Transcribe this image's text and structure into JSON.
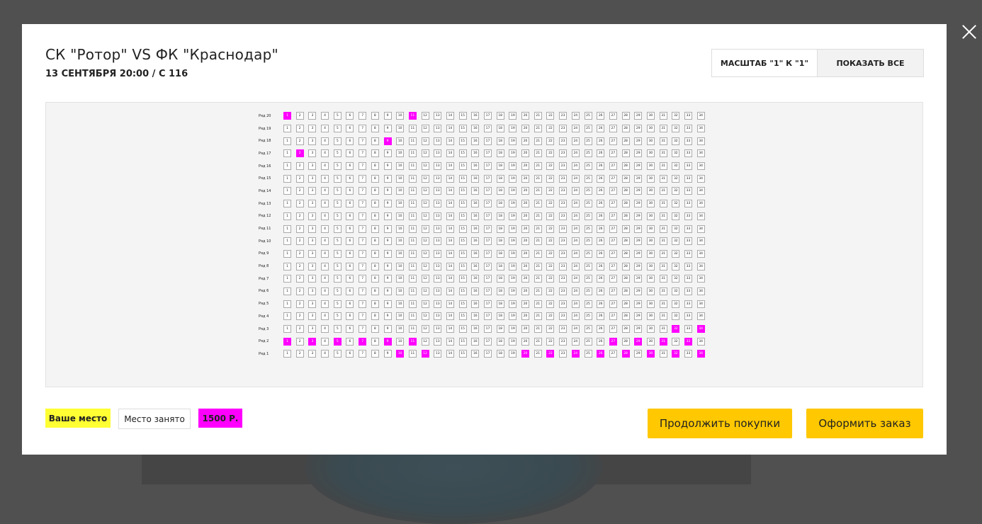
{
  "header": {
    "title": "СК \"Ротор\" VS ФК \"Краснодар\"",
    "subtitle": "13 СЕНТЯБРЯ 20:00 / С 116"
  },
  "toolbar": {
    "scale_label": "МАСШТАБ \"1\" К \"1\"",
    "show_all_label": "ПОКАЗАТЬ ВСЕ"
  },
  "seat_map": {
    "seats_per_row": 34,
    "rows": [
      {
        "label": "Ряд 20",
        "priced": [
          1,
          11
        ]
      },
      {
        "label": "Ряд 19",
        "priced": []
      },
      {
        "label": "Ряд 18",
        "priced": [
          9
        ]
      },
      {
        "label": "Ряд 17",
        "priced": [
          2
        ]
      },
      {
        "label": "Ряд 16",
        "priced": []
      },
      {
        "label": "Ряд 15",
        "priced": []
      },
      {
        "label": "Ряд 14",
        "priced": []
      },
      {
        "label": "Ряд 13",
        "priced": []
      },
      {
        "label": "Ряд 12",
        "priced": []
      },
      {
        "label": "Ряд 11",
        "priced": []
      },
      {
        "label": "Ряд 10",
        "priced": []
      },
      {
        "label": "Ряд 9",
        "priced": []
      },
      {
        "label": "Ряд 8",
        "priced": []
      },
      {
        "label": "Ряд 7",
        "priced": []
      },
      {
        "label": "Ряд 6",
        "priced": []
      },
      {
        "label": "Ряд 5",
        "priced": []
      },
      {
        "label": "Ряд 4",
        "priced": []
      },
      {
        "label": "Ряд 3",
        "priced": [
          32,
          34
        ]
      },
      {
        "label": "Ряд 2",
        "priced": [
          1,
          3,
          5,
          7,
          9,
          11,
          27,
          29,
          31,
          33
        ]
      },
      {
        "label": "Ряд 1",
        "priced": [
          10,
          12,
          20,
          22,
          24,
          26,
          28,
          30,
          32,
          34
        ]
      }
    ]
  },
  "legend": {
    "your_seat": "Ваше место",
    "taken_seat": "Место занято",
    "price": "1500 Р."
  },
  "actions": {
    "continue_label": "Продолжить покупки",
    "order_label": "Оформить заказ"
  },
  "colors": {
    "accent": "#ffc800",
    "your_seat": "#ffff33",
    "price": "#ff00ff"
  }
}
